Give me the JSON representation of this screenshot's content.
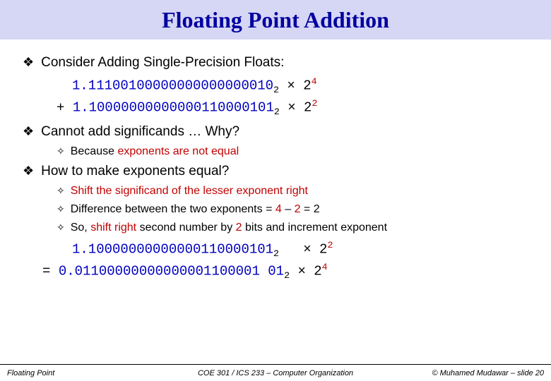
{
  "title": "Floating Point Addition",
  "lines": {
    "consider": "Consider Adding Single-Precision Floats:",
    "cannot": "Cannot add significands … Why?",
    "because_pre": "Because ",
    "because_red": "exponents are not equal",
    "how": "How to make exponents equal?",
    "shift": "Shift the significand of the lesser exponent right",
    "diff_pre": "Difference between the two exponents = ",
    "diff_four": "4",
    "diff_minus": " – ",
    "diff_two": "2",
    "diff_equals": " = 2",
    "so_pre": "So, ",
    "so_red": "shift right",
    "so_mid": " second number by ",
    "so_two": "2",
    "so_post": " bits and increment exponent"
  },
  "code": {
    "num1_mantissa": "1.11100100000000000000010",
    "num1_sub": "2",
    "num1_mid": " × 2",
    "num1_exp": "4",
    "plus": "+ ",
    "num2_mantissa": "1.10000000000000110000101",
    "num2_sub": "2",
    "num2_mid": " × 2",
    "num2_exp": "2",
    "num3_mantissa": "1.10000000000000110000101",
    "num3_sub": "2",
    "num3_spaces": "   ",
    "num3_mid": "× 2",
    "num3_exp": "2",
    "eq": "= ",
    "num4_mantissa": "0.01100000000000001100001 01",
    "num4_sub": "2",
    "num4_mid": " × 2",
    "num4_exp": "4"
  },
  "footer": {
    "left": "Floating Point",
    "center": "COE 301 / ICS 233 – Computer Organization",
    "right": "© Muhamed Mudawar – slide 20"
  }
}
